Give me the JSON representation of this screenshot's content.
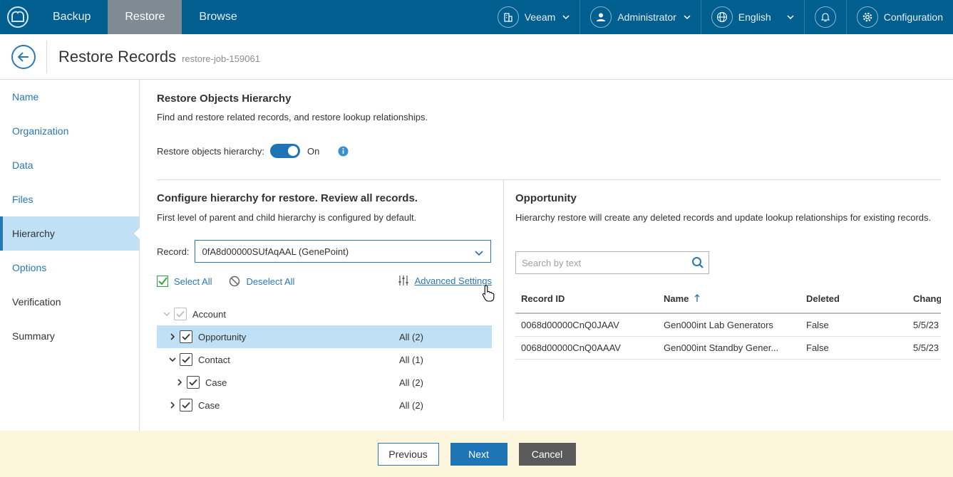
{
  "topbar": {
    "tabs": [
      "Backup",
      "Restore",
      "Browse"
    ],
    "active_tab": "Restore",
    "org": "Veeam",
    "user": "Administrator",
    "language": "English",
    "config": "Configuration"
  },
  "header": {
    "title": "Restore Records",
    "job": "restore-job-159061"
  },
  "sidebar": {
    "items": [
      {
        "label": "Name"
      },
      {
        "label": "Organization"
      },
      {
        "label": "Data"
      },
      {
        "label": "Files"
      },
      {
        "label": "Hierarchy"
      },
      {
        "label": "Options"
      },
      {
        "label": "Verification"
      },
      {
        "label": "Summary"
      }
    ]
  },
  "main": {
    "title": "Restore Objects Hierarchy",
    "description": "Find and restore related records, and restore lookup relationships.",
    "toggle_label": "Restore objects hierarchy:",
    "toggle_state": "On"
  },
  "left": {
    "title": "Configure hierarchy for restore. Review all records.",
    "description": "First level of parent and child hierarchy is configured by default.",
    "record_label": "Record:",
    "record_value": "0fA8d00000SUfAqAAL (GenePoint)",
    "select_all": "Select All",
    "deselect_all": "Deselect All",
    "advanced": "Advanced Settings",
    "tree": [
      {
        "label": "Account",
        "count": ""
      },
      {
        "label": "Opportunity",
        "count": "All (2)"
      },
      {
        "label": "Contact",
        "count": "All (1)"
      },
      {
        "label": "Case",
        "count": "All (2)"
      },
      {
        "label": "Case",
        "count": "All (2)"
      }
    ]
  },
  "right": {
    "title": "Opportunity",
    "description": "Hierarchy restore will create any deleted records and update lookup relationships for existing records.",
    "search_placeholder": "Search by text",
    "columns": [
      "Record ID",
      "Name",
      "Deleted",
      "Chang"
    ],
    "rows": [
      {
        "id": "0068d00000CnQ0JAAV",
        "name": "Gen000int Lab Generators",
        "deleted": "False",
        "changed": "5/5/23"
      },
      {
        "id": "0068d00000CnQ0AAAV",
        "name": "Gen000int Standby Gener...",
        "deleted": "False",
        "changed": "5/5/23"
      }
    ]
  },
  "footer": {
    "previous": "Previous",
    "next": "Next",
    "cancel": "Cancel"
  }
}
